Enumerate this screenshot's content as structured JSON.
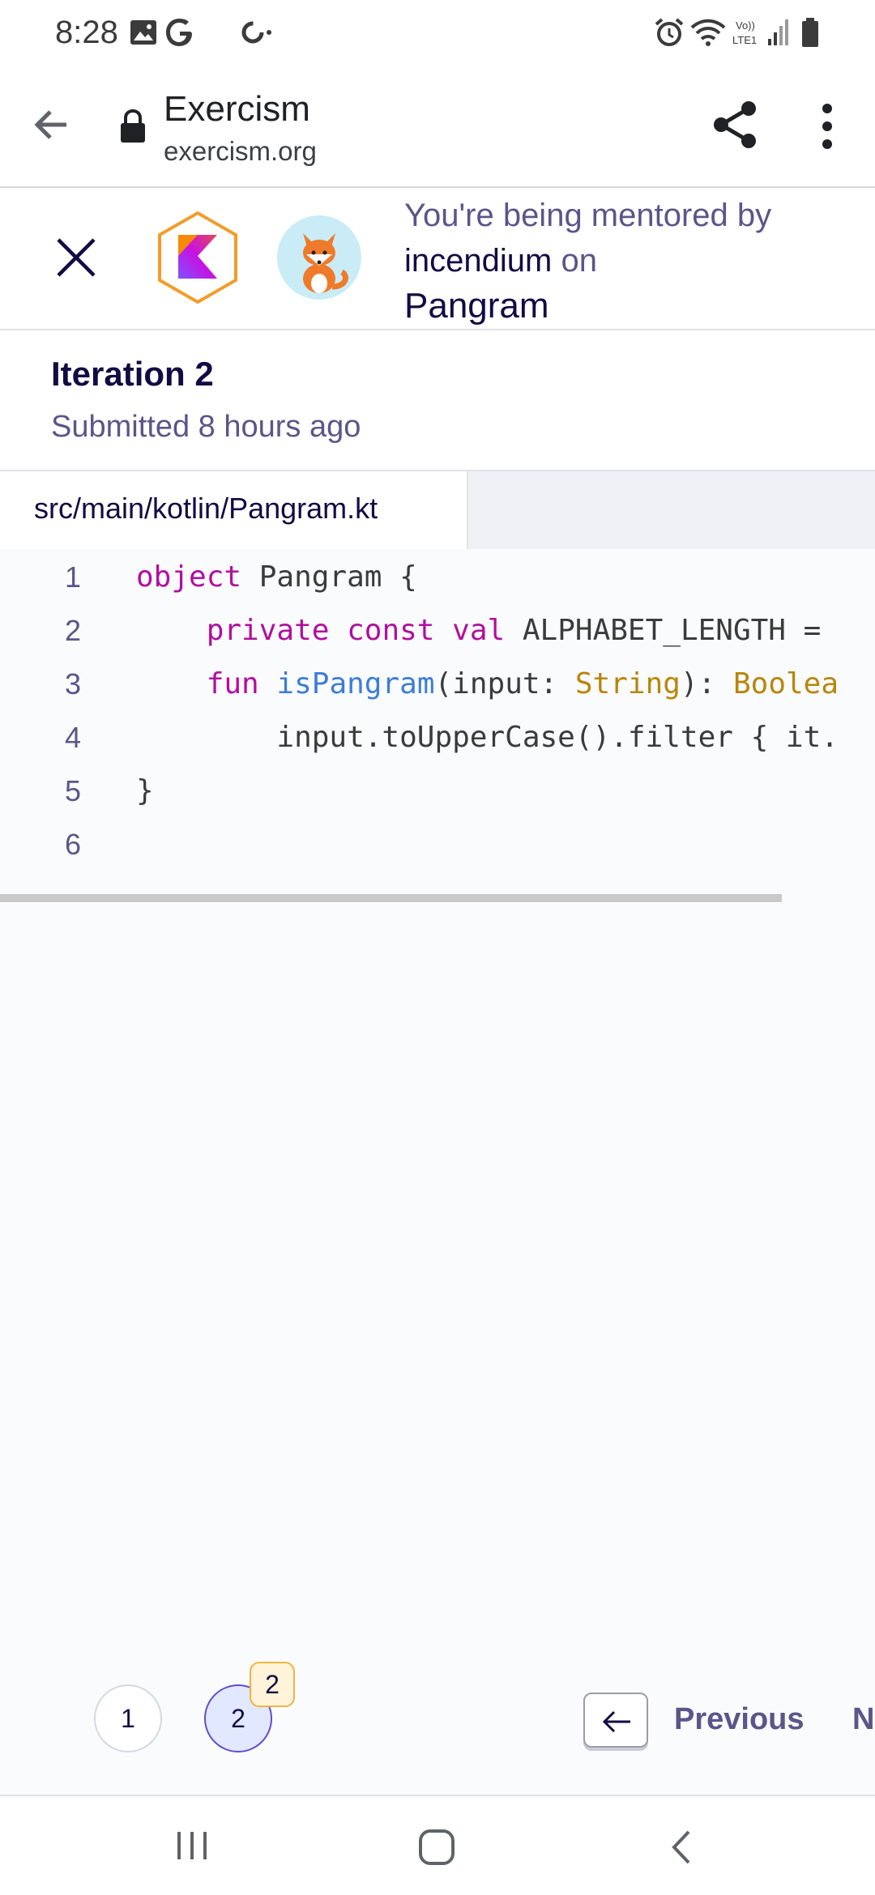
{
  "status_bar": {
    "time": "8:28",
    "icons": [
      "image-icon",
      "google-icon",
      "assistant-icon",
      "alarm-icon",
      "wifi-icon",
      "volte-icon",
      "signal-icon",
      "battery-icon"
    ]
  },
  "browser": {
    "site_title": "Exercism",
    "url": "exercism.org",
    "back_icon": "arrow-left-icon",
    "lock_icon": "lock-icon",
    "share_icon": "share-icon",
    "menu_icon": "more-vert-icon"
  },
  "mentoring": {
    "prefix": "You're being mentored by",
    "mentor": "incendium",
    "connector": "on",
    "exercise": "Pangram",
    "track_icon": "kotlin-icon",
    "close_icon": "close-icon"
  },
  "iteration": {
    "title": "Iteration 2",
    "submitted": "Submitted 8 hours ago"
  },
  "file": {
    "path": "src/main/kotlin/Pangram.kt"
  },
  "code": {
    "lines": [
      {
        "num": "1",
        "tokens": [
          {
            "t": "object",
            "k": "kw"
          },
          {
            "t": " Pangram {",
            "k": ""
          }
        ]
      },
      {
        "num": "2",
        "tokens": [
          {
            "t": "    ",
            "k": ""
          },
          {
            "t": "private",
            "k": "kw"
          },
          {
            "t": " ",
            "k": ""
          },
          {
            "t": "const",
            "k": "kw"
          },
          {
            "t": " ",
            "k": ""
          },
          {
            "t": "val",
            "k": "kw"
          },
          {
            "t": " ALPHABET_LENGTH =",
            "k": ""
          }
        ]
      },
      {
        "num": "3",
        "tokens": [
          {
            "t": "    ",
            "k": ""
          },
          {
            "t": "fun",
            "k": "kw"
          },
          {
            "t": " ",
            "k": ""
          },
          {
            "t": "isPangram",
            "k": "fn"
          },
          {
            "t": "(input: ",
            "k": ""
          },
          {
            "t": "String",
            "k": "ty"
          },
          {
            "t": "): ",
            "k": ""
          },
          {
            "t": "Boolea",
            "k": "ty"
          }
        ]
      },
      {
        "num": "4",
        "tokens": [
          {
            "t": "        input.toUpperCase().filter { it.",
            "k": ""
          }
        ]
      },
      {
        "num": "5",
        "tokens": [
          {
            "t": "}",
            "k": ""
          }
        ]
      },
      {
        "num": "6",
        "tokens": []
      }
    ]
  },
  "footer": {
    "iterations": [
      "1",
      "2"
    ],
    "selected": "2",
    "badge": "2",
    "prev_label": "Previous",
    "next_label": "N",
    "prev_icon": "arrow-left-icon"
  },
  "navbar": {
    "icons": [
      "recents-icon",
      "home-icon",
      "back-icon"
    ]
  }
}
